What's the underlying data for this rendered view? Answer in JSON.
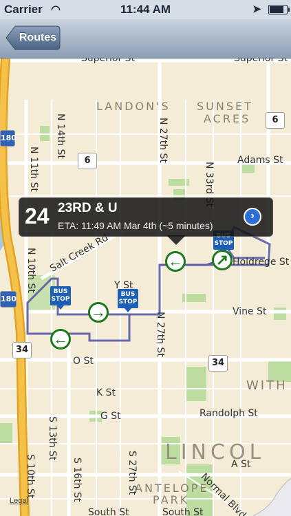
{
  "status_bar": {
    "carrier": "Carrier",
    "time": "11:44 AM"
  },
  "nav": {
    "back_label": "Routes"
  },
  "callout": {
    "route_number": "24",
    "stop_name": "23RD & U",
    "eta": "ETA: 11:49 AM Mar 4th (~5 minutes)"
  },
  "map": {
    "areas": [
      "LANDON'S",
      "SUNSET",
      "ACRES",
      "WITH",
      "LINCOL",
      "ANTELOPE",
      "PARK"
    ],
    "streets": {
      "superior_left": "Superior St",
      "superior_right": "Superior St",
      "adams": "Adams St",
      "vine": "Vine St",
      "o": "O St",
      "k": "K St",
      "g": "G St",
      "randolph": "Randolph St",
      "a": "A St",
      "south_left": "South St",
      "south_right": "South St",
      "n14": "N 14th St",
      "n11": "N 11th St",
      "n10": "N 10th St",
      "n27": "N 27th St",
      "n27b": "N 27th St",
      "n33": "N 33rd St",
      "salt_creek": "Salt Creek Rd",
      "y": "Y St",
      "holdrege": "Holdrege St",
      "s13": "S 13th St",
      "s10": "S 10th St",
      "s16": "S 16th St",
      "s27": "S 27th St",
      "normal": "Normal Blvd"
    },
    "shields": [
      "6",
      "6",
      "34",
      "34",
      "180",
      "180"
    ],
    "bus_stop_label": "BUS STOP",
    "legal": "Legal"
  },
  "colors": {
    "route_line": "#5a5aa8",
    "pin_green": "#1b7a1b",
    "bus_stop_blue": "#1c5fb4",
    "highway": "#f2b531"
  }
}
